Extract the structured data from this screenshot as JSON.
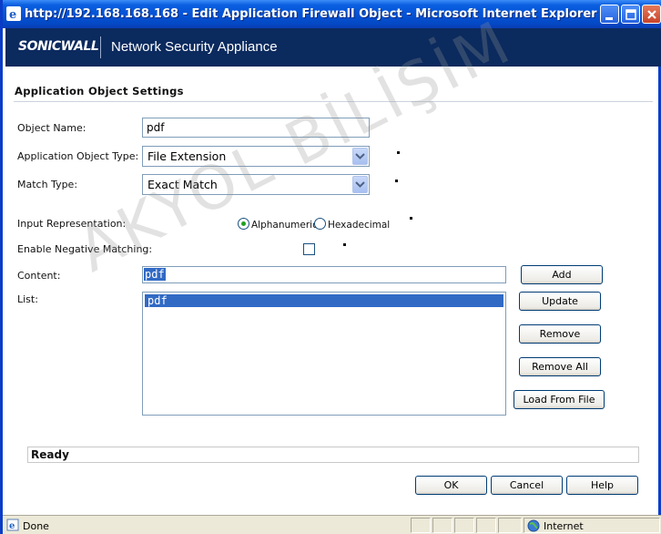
{
  "window": {
    "title": "http://192.168.168.168 - Edit Application Firewall Object - Microsoft Internet Explorer"
  },
  "banner": {
    "logo": "SONICWALL",
    "product": "Network Security Appliance"
  },
  "section": {
    "title": "Application Object Settings"
  },
  "form": {
    "object_name_label": "Object Name:",
    "object_name_value": "pdf",
    "object_type_label": "Application Object Type:",
    "object_type_value": "File Extension",
    "match_type_label": "Match Type:",
    "match_type_value": "Exact Match",
    "input_rep_label": "Input Representation:",
    "radio_alpha": "Alphanumeric",
    "radio_hex": "Hexadecimal",
    "radio_selected": "Alphanumeric",
    "neg_match_label": "Enable Negative Matching:",
    "neg_match_checked": false,
    "content_label": "Content:",
    "content_value": "pdf",
    "list_label": "List:",
    "list_items": [
      "pdf"
    ]
  },
  "buttons": {
    "add": "Add",
    "update": "Update",
    "remove": "Remove",
    "remove_all": "Remove All",
    "load_from_file": "Load From File",
    "ok": "OK",
    "cancel": "Cancel",
    "help": "Help"
  },
  "status": {
    "frame_text": "Ready"
  },
  "watermark": {
    "text": "AKYOL BİLİŞİM"
  },
  "ie_status": {
    "left": "Done",
    "zone": "Internet"
  },
  "colors": {
    "title_bar": "#0553d6",
    "banner": "#0b2a5e",
    "selection": "#316ac5"
  }
}
